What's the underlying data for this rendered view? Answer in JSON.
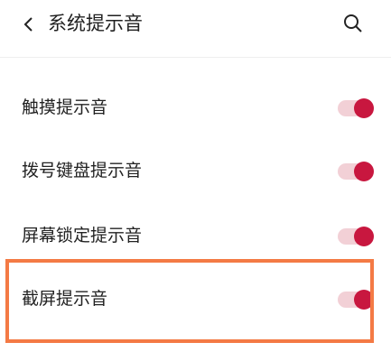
{
  "header": {
    "title": "系统提示音",
    "back_icon": "chevron-left-icon",
    "search_icon": "search-icon"
  },
  "settings": [
    {
      "label": "触摸提示音",
      "enabled": true
    },
    {
      "label": "拨号键盘提示音",
      "enabled": true
    },
    {
      "label": "屏幕锁定提示音",
      "enabled": true
    },
    {
      "label": "截屏提示音",
      "enabled": true
    }
  ],
  "colors": {
    "toggle_on_knob": "#c8173f",
    "toggle_on_track": "#f2d0d6",
    "highlight_border": "#f47a45"
  }
}
